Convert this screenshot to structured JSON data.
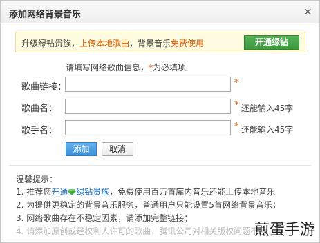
{
  "dialog": {
    "title": "添加网络背景音乐",
    "close_glyph": "×"
  },
  "banner": {
    "prefix": "升级绿钻贵族，",
    "upload_text": "上传本地歌曲",
    "middle": "，背景音乐",
    "free_text": "免费使用",
    "button_label": "开通绿钻"
  },
  "form": {
    "hint_prefix": "请填写网络歌曲信息，",
    "hint_star": "*",
    "hint_suffix": "为必填项",
    "song_link_label": "歌曲链接：",
    "song_link_value": "",
    "song_name_label": "歌曲名：",
    "song_name_value": "",
    "singer_label": "歌手名：",
    "singer_value": "",
    "required_mark": "*",
    "remaining_song_name": "还能输入45字",
    "remaining_singer": "还能输入45字",
    "add_button": "添加",
    "cancel_button": "取消"
  },
  "tips": {
    "title": "温馨提示：",
    "tip1_prefix": "1. 推荐您",
    "tip1_link": "开通",
    "tip1_link2": "绿钻贵族",
    "tip1_suffix": "，免费使用百万首库内音乐还能上传本地音乐",
    "tip2": "2. 为提供更稳定的背景音乐服务，普通用户只能设置5首网络背景音乐；",
    "tip3": "3. 网络歌曲存在不稳定因素，请添加完整链接；",
    "tip4": "4. 请添加原创或经权利人许可的歌曲，腾讯公司对相关版权问题不承"
  },
  "watermark": "煎蛋手游",
  "colors": {
    "accent_orange": "#e45b00",
    "link_blue": "#1a6fc2",
    "green_button": "#3f9a3f",
    "blue_button": "#3b8fd8"
  }
}
